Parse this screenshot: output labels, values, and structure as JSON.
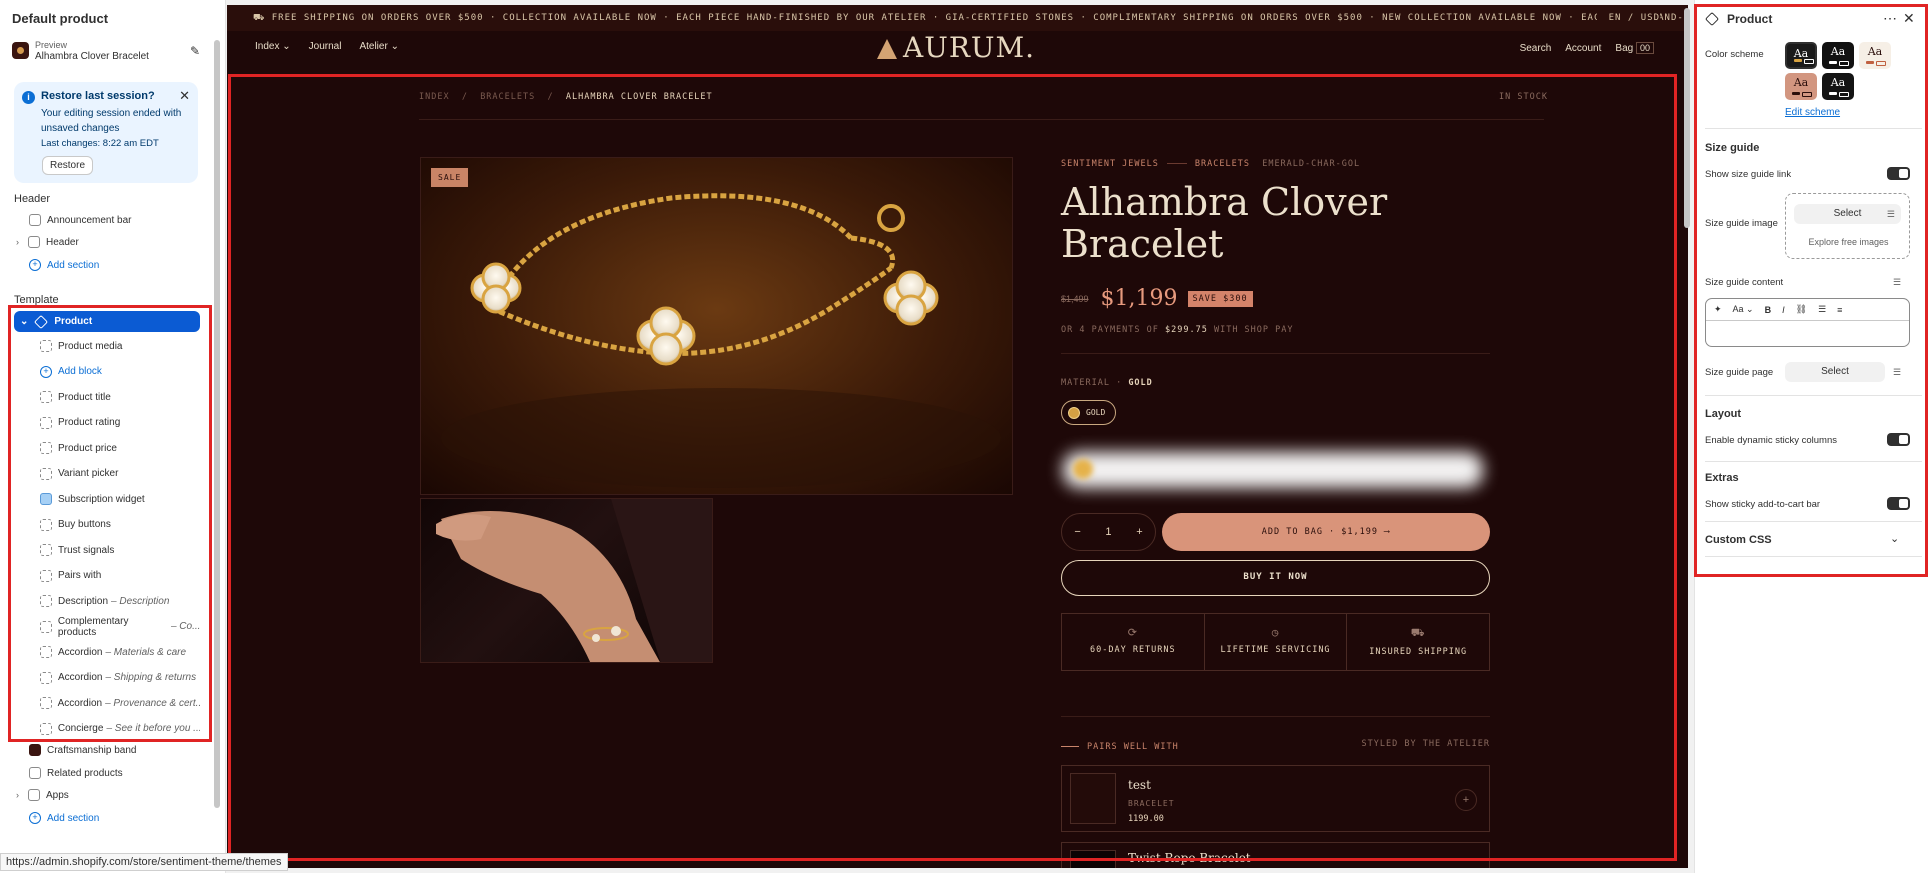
{
  "left": {
    "title": "Default product",
    "preview_caption": "Preview",
    "preview_name": "Alhambra Clover Bracelet",
    "restore": {
      "title": "Restore last session?",
      "message": "Your editing session ended with unsaved changes",
      "last": "Last changes: 8:22 am EDT",
      "button": "Restore"
    },
    "header_label": "Header",
    "announcement_bar": "Announcement bar",
    "header_item": "Header",
    "add_section": "Add section",
    "template_label": "Template",
    "product": "Product",
    "blocks": [
      {
        "label": "Product media",
        "note": ""
      },
      {
        "label": "Add block",
        "note": ""
      },
      {
        "label": "Product title",
        "note": ""
      },
      {
        "label": "Product rating",
        "note": ""
      },
      {
        "label": "Product price",
        "note": ""
      },
      {
        "label": "Variant picker",
        "note": ""
      },
      {
        "label": "Subscription widget",
        "note": ""
      },
      {
        "label": "Buy buttons",
        "note": ""
      },
      {
        "label": "Trust signals",
        "note": ""
      },
      {
        "label": "Pairs with",
        "note": ""
      },
      {
        "label": "Description",
        "note": "– Description"
      },
      {
        "label": "Complementary products",
        "note": "– Co..."
      },
      {
        "label": "Accordion",
        "note": "– Materials & care"
      },
      {
        "label": "Accordion",
        "note": "– Shipping & returns"
      },
      {
        "label": "Accordion",
        "note": "– Provenance & cert..."
      },
      {
        "label": "Concierge",
        "note": "– See it before you ..."
      }
    ],
    "craftsmanship": "Craftsmanship band",
    "related": "Related products",
    "apps": "Apps",
    "add_section_2": "Add section",
    "status_url": "https://admin.shopify.com/store/sentiment-theme/themes"
  },
  "store": {
    "announcement": "⛟ FREE SHIPPING ON ORDERS OVER $500 · COLLECTION AVAILABLE NOW · EACH PIECE HAND-FINISHED BY OUR ATELIER · GIA-CERTIFIED STONES · COMPLIMENTARY SHIPPING ON ORDERS OVER $500 · NEW COLLECTION AVAILABLE NOW · EACH PIECE HAND-FINISHED BY",
    "currency": "EN / USD",
    "nav_left": [
      "Index",
      "Journal",
      "Atelier"
    ],
    "logo": "AURUM.",
    "nav_right": [
      "Search",
      "Account",
      "Bag"
    ],
    "bag_count": "00",
    "breadcrumb": [
      "INDEX",
      "BRACELETS",
      "ALHAMBRA CLOVER BRACELET"
    ],
    "stock": "IN STOCK",
    "sale_badge": "SALE",
    "vendor": "SENTIMENT JEWELS",
    "category": "BRACELETS",
    "sku": "EMERALD-CHAR-GOL",
    "title": "Alhambra Clover Bracelet",
    "price_was": "$1,499",
    "price_now": "$1,199",
    "save": "SAVE $300",
    "installments_pre": "OR 4 PAYMENTS OF",
    "installments_amt": "$299.75",
    "installments_post": "WITH SHOP PAY",
    "material_label": "MATERIAL",
    "material_value": "GOLD",
    "swatch": "GOLD",
    "qty": "1",
    "add_to_bag": "ADD TO BAG · $1,199 ⟶",
    "buy_now": "BUY IT NOW",
    "trust": [
      "60-DAY RETURNS",
      "LIFETIME SERVICING",
      "INSURED SHIPPING"
    ],
    "pairs_label": "PAIRS WELL WITH",
    "styled_label": "STYLED BY THE ATELIER",
    "pair1_name": "test",
    "pair1_type": "BRACELET",
    "pair1_price": "1199.00",
    "pair2_name": "Twist Rope Bracelet"
  },
  "right": {
    "title": "Product",
    "color_scheme": "Color scheme",
    "scheme_sample": "Aa",
    "edit_scheme": "Edit scheme",
    "size_guide": "Size guide",
    "show_link": "Show size guide link",
    "guide_image": "Size guide image",
    "select": "Select",
    "explore": "Explore free images",
    "guide_content": "Size guide content",
    "guide_page": "Size guide page",
    "layout": "Layout",
    "sticky_cols": "Enable dynamic sticky columns",
    "extras": "Extras",
    "sticky_atc": "Show sticky add-to-cart bar",
    "custom_css": "Custom CSS"
  },
  "colors": {
    "selection_blue": "#0b5bd3",
    "highlight_red": "#e02424",
    "store_bg": "#1e0808",
    "accent_copper": "#d9947a"
  }
}
